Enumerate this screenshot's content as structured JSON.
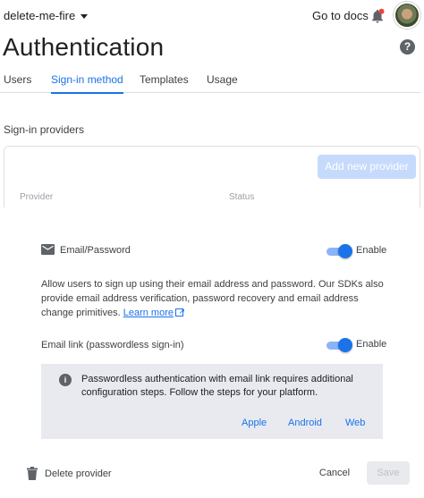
{
  "topbar": {
    "project_name": "delete-me-fire",
    "docs_label": "Go to docs"
  },
  "page": {
    "title": "Authentication"
  },
  "tabs": [
    {
      "label": "Users",
      "active": false
    },
    {
      "label": "Sign-in method",
      "active": true
    },
    {
      "label": "Templates",
      "active": false
    },
    {
      "label": "Usage",
      "active": false
    }
  ],
  "providers": {
    "section_label": "Sign-in providers",
    "add_button": "Add new provider",
    "columns": [
      "Provider",
      "Status"
    ]
  },
  "panel": {
    "email_password_label": "Email/Password",
    "email_password_enabled": true,
    "enable_label": "Enable",
    "description": "Allow users to sign up using their email address and password. Our SDKs also provide email address verification, password recovery and email address change primitives.",
    "learn_more": "Learn more",
    "email_link_label": "Email link (passwordless sign-in)",
    "email_link_enabled": true,
    "info_text": "Passwordless authentication with email link requires additional configuration steps. Follow the steps for your platform.",
    "platforms": [
      "Apple",
      "Android",
      "Web"
    ],
    "delete_label": "Delete provider",
    "cancel_label": "Cancel",
    "save_label": "Save"
  },
  "colors": {
    "accent": "#1a73e8",
    "info_bg": "#e8eaf0",
    "disabled_button": "#c6dafc"
  }
}
